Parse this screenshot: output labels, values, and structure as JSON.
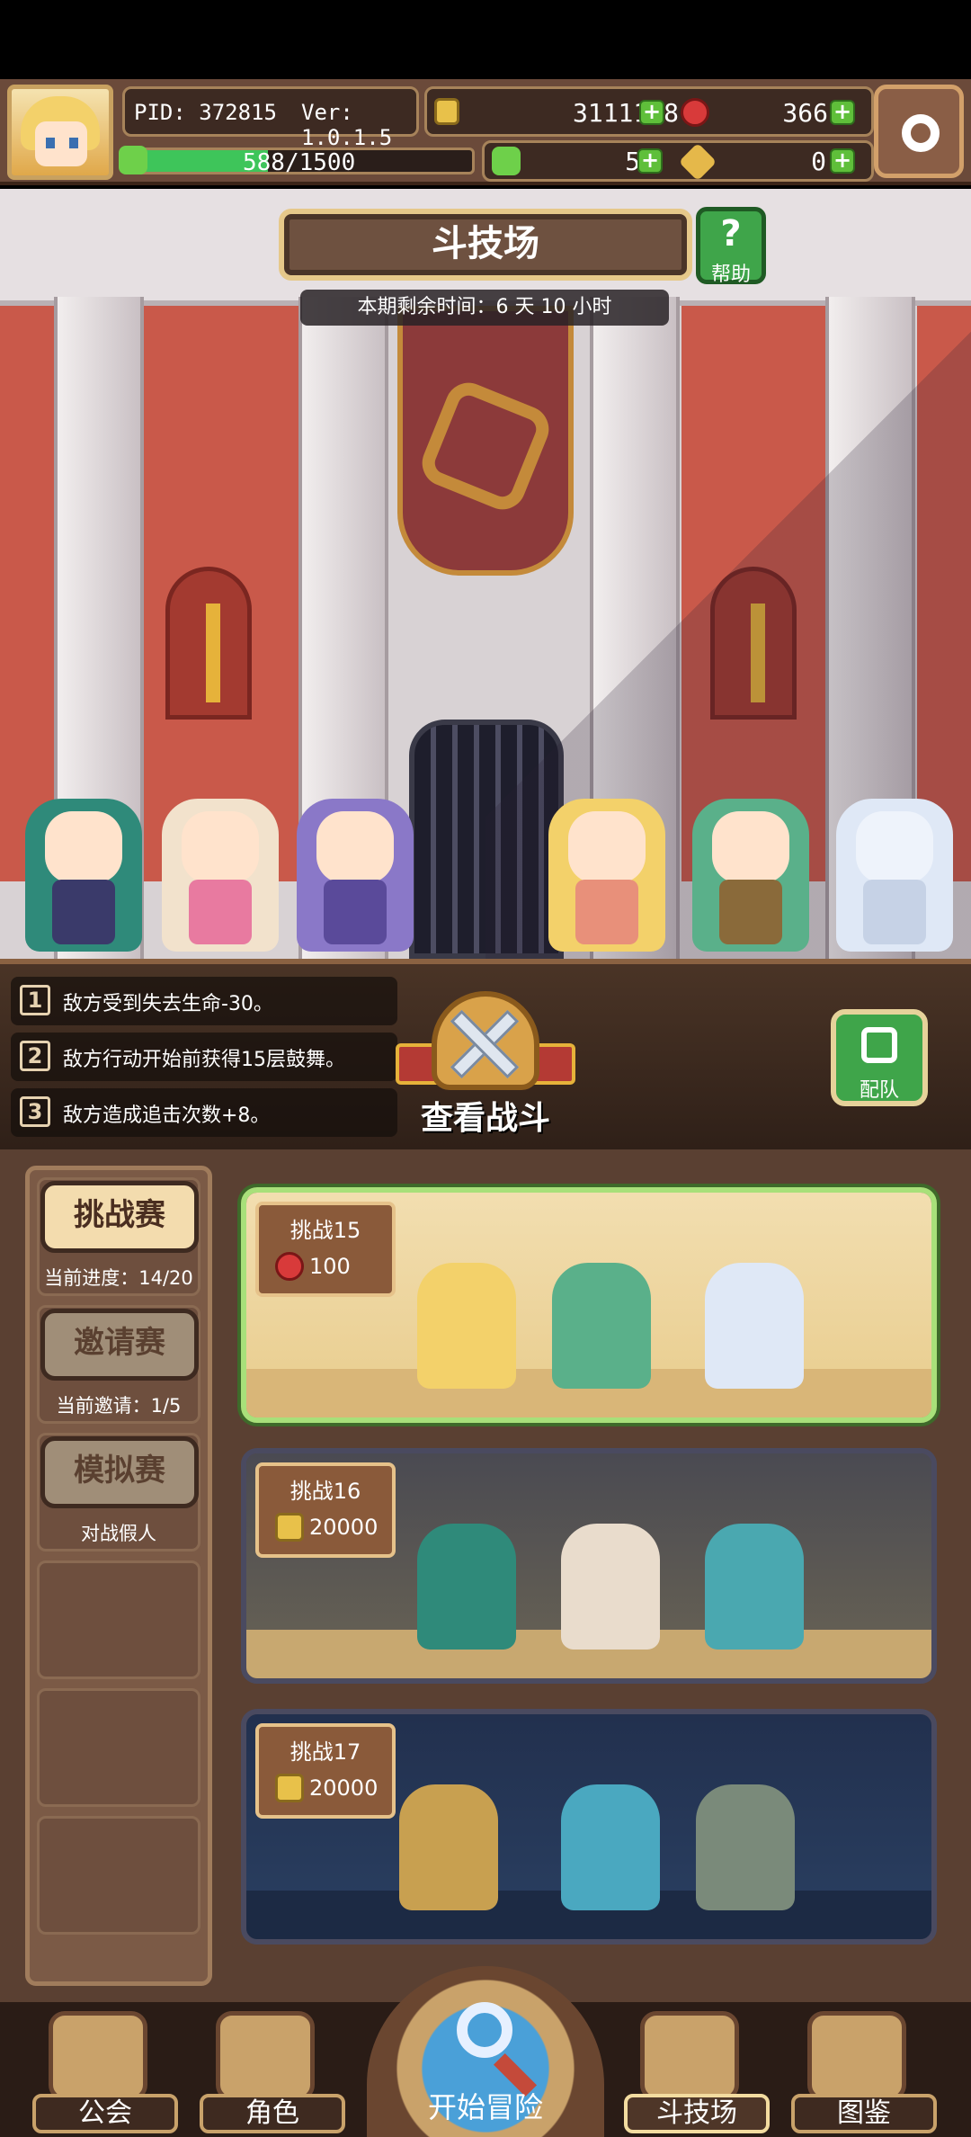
{
  "hud": {
    "pid": "PID: 372815",
    "version": "Ver: 1.0.1.5",
    "gold": "3111188",
    "gems": "366",
    "stamina": "588/1500",
    "stamina_fraction": 0.392,
    "clover": "56",
    "keys": "0"
  },
  "arena": {
    "title": "斗技场",
    "help_label": "帮助",
    "timer": "本期剩余时间：6 天 10 小时"
  },
  "effects": [
    {
      "num": "1",
      "text": "敌方受到失去生命-30。"
    },
    {
      "num": "2",
      "text": "敌方行动开始前获得15层鼓舞。"
    },
    {
      "num": "3",
      "text": "敌方造成追击次数+8。"
    }
  ],
  "actions": {
    "view_battle": "查看战斗",
    "team": "配队"
  },
  "modes": [
    {
      "label": "挑战赛",
      "sub": "当前进度：14/20",
      "active": true
    },
    {
      "label": "邀请赛",
      "sub": "当前邀请：1/5",
      "active": false
    },
    {
      "label": "模拟赛",
      "sub": "对战假人",
      "active": false
    }
  ],
  "challenges": [
    {
      "title": "挑战15",
      "cost": "100",
      "currency_icon": "gem-icon"
    },
    {
      "title": "挑战16",
      "cost": "20000",
      "currency_icon": "gold-coin-icon"
    },
    {
      "title": "挑战17",
      "cost": "20000",
      "currency_icon": "gold-coin-icon"
    }
  ],
  "nav": {
    "guild": "公会",
    "character": "角色",
    "start": "开始冒险",
    "arena": "斗技场",
    "codex": "图鉴"
  },
  "colors": {
    "active_border": "#a8e07a",
    "gem": "#d83a3a",
    "coin": "#e8c14a",
    "plus": "#5fbf3a"
  }
}
